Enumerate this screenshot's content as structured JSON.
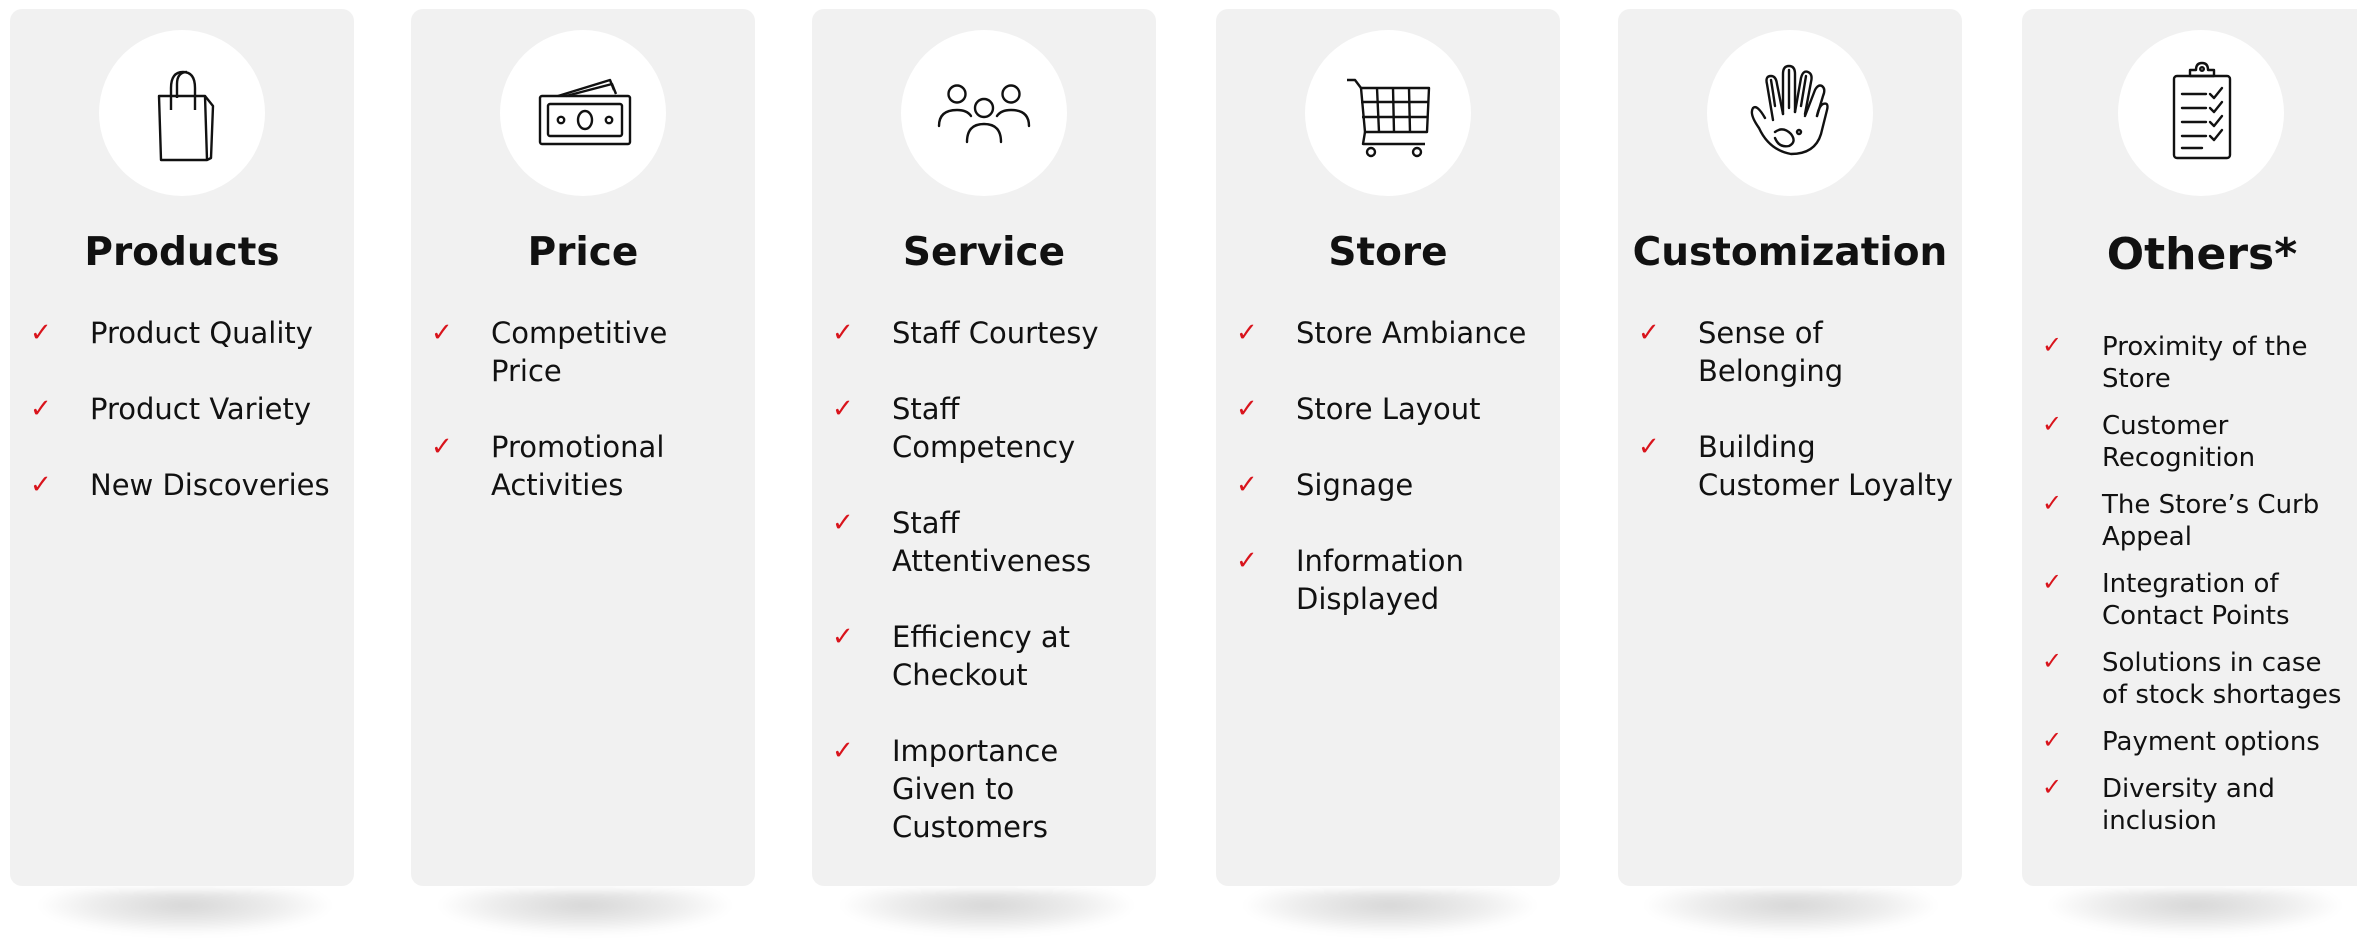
{
  "colors": {
    "card_background": "#f1f1f1",
    "check_mark": "#d9141c",
    "text": "#111111"
  },
  "check_glyph": "✓",
  "cards": [
    {
      "icon": "shopping-bag-icon",
      "title": "Products",
      "items": [
        "Product Quality",
        "Product Variety",
        "New Discoveries"
      ]
    },
    {
      "icon": "money-bill-icon",
      "title": "Price",
      "items": [
        "Competitive Price",
        "Promotional Activities"
      ]
    },
    {
      "icon": "people-group-icon",
      "title": "Service",
      "items": [
        "Staff Courtesy",
        "Staff Competency",
        "Staff Attentiveness",
        "Efficiency at Checkout",
        "Importance Given to Customers"
      ]
    },
    {
      "icon": "shopping-cart-icon",
      "title": "Store",
      "items": [
        "Store Ambiance",
        "Store Layout",
        "Signage",
        "Information Displayed"
      ]
    },
    {
      "icon": "hand-print-icon",
      "title": "Customization",
      "items": [
        "Sense of Belonging",
        "Building Customer Loyalty"
      ]
    },
    {
      "icon": "clipboard-checklist-icon",
      "title": "Others*",
      "items": [
        "Proximity of the Store",
        "Customer Recognition",
        "The Store’s Curb Appeal",
        "Integration of Contact Points",
        "Solutions in case of stock shortages",
        "Payment options",
        "Diversity and inclusion"
      ]
    }
  ]
}
